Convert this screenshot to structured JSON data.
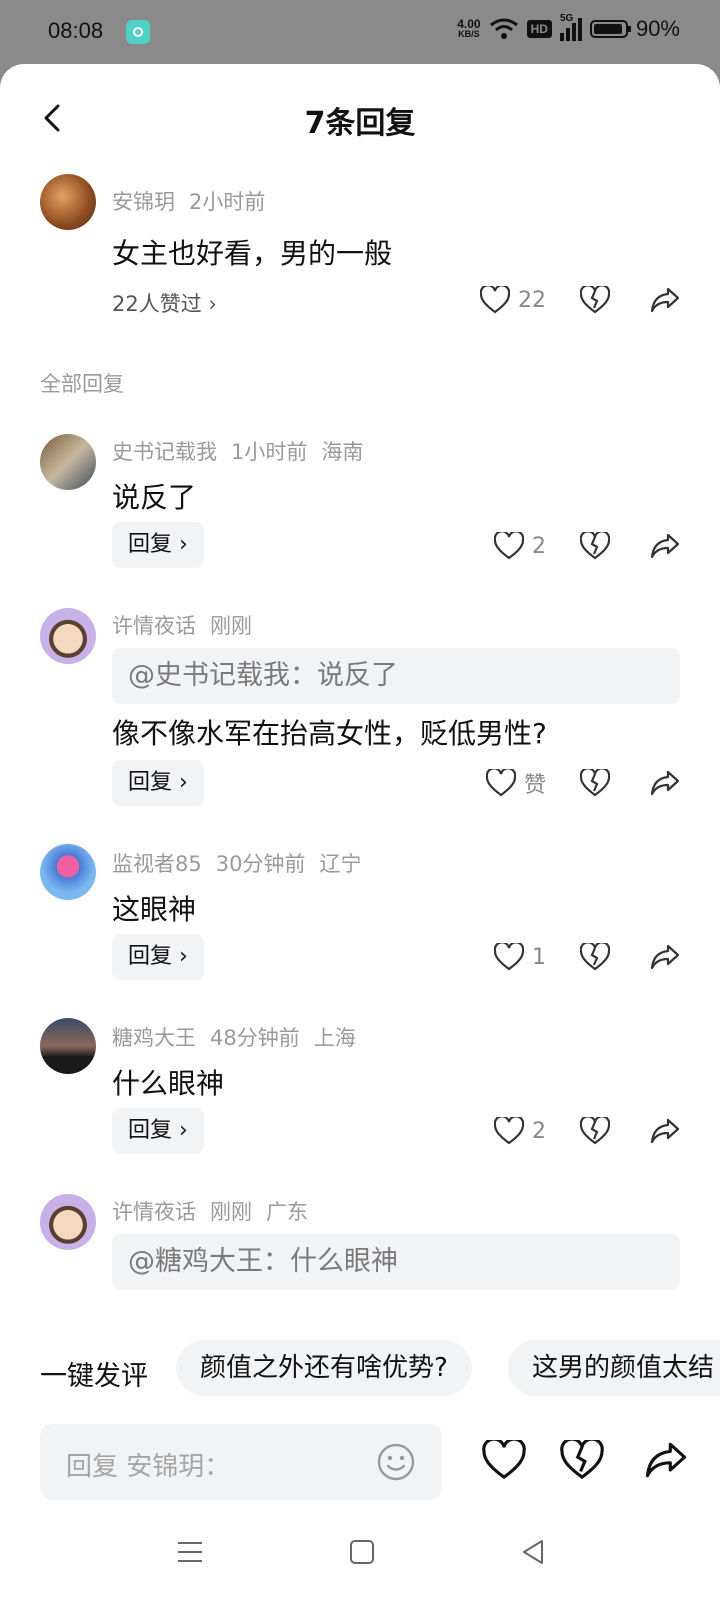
{
  "status_bar": {
    "time": "08:08",
    "net_speed": "4.00",
    "net_unit": "KB/S",
    "hd": "HD",
    "signal": "5G",
    "battery": "90%"
  },
  "header": {
    "title": "7条回复"
  },
  "main_comment": {
    "author": "安锦玥",
    "time": "2小时前",
    "text": "女主也好看，男的一般",
    "likes_summary": "22人赞过 ›",
    "like_count": "22"
  },
  "section_label": "全部回复",
  "replies": [
    {
      "author": "史书记载我",
      "time": "1小时前",
      "location": "海南",
      "text": "说反了",
      "reply_label": "回复 ›",
      "like_count": "2"
    },
    {
      "author": "许情夜话",
      "time": "刚刚",
      "location": "",
      "quote": "@史书记载我：说反了",
      "text": "像不像水军在抬高女性，贬低男性?",
      "reply_label": "回复 ›",
      "like_count": "赞"
    },
    {
      "author": "监视者85",
      "time": "30分钟前",
      "location": "辽宁",
      "text": "这眼神",
      "reply_label": "回复 ›",
      "like_count": "1"
    },
    {
      "author": "糖鸡大王",
      "time": "48分钟前",
      "location": "上海",
      "text": "什么眼神",
      "reply_label": "回复 ›",
      "like_count": "2"
    },
    {
      "author": "许情夜话",
      "time": "刚刚",
      "location": "广东",
      "quote": "@糖鸡大王：什么眼神"
    }
  ],
  "quick_comment": {
    "label": "一键发评",
    "chips": [
      "颜值之外还有啥优势?",
      "这男的颜值太结"
    ]
  },
  "input": {
    "placeholder": "回复 安锦玥："
  },
  "icons": {
    "back": "back-arrow-icon",
    "like": "heart-icon",
    "dislike": "broken-heart-icon",
    "share": "share-icon",
    "emoji": "emoji-icon"
  }
}
